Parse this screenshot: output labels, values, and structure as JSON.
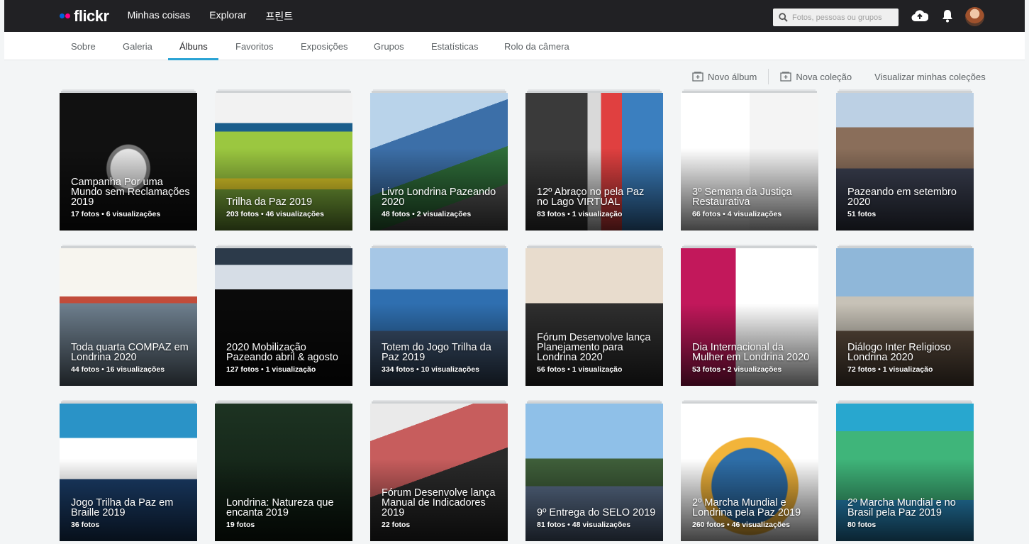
{
  "header": {
    "logo_text": "flickr",
    "nav": [
      "Minhas coisas",
      "Explorar",
      "프린트"
    ],
    "search_placeholder": "Fotos, pessoas ou grupos"
  },
  "subnav": {
    "tabs": [
      "Sobre",
      "Galeria",
      "Álbuns",
      "Favoritos",
      "Exposições",
      "Grupos",
      "Estatísticas",
      "Rolo da câmera"
    ],
    "active": "Álbuns"
  },
  "actions": {
    "new_album": "Novo álbum",
    "new_collection": "Nova coleção",
    "view_collections": "Visualizar minhas coleções"
  },
  "albums": [
    {
      "title": "Campanha Por uma Mundo sem Reclamações 2019",
      "stats": "17 fotos  •  6 visualizações"
    },
    {
      "title": "Trilha da Paz 2019",
      "stats": "203 fotos  •  46 visualizações"
    },
    {
      "title": "Livro Londrina Pazeando 2020",
      "stats": "48 fotos  •  2 visualizações"
    },
    {
      "title": "12º Abraço no pela Paz no Lago VIRTUAL",
      "stats": "83 fotos  •  1 visualização"
    },
    {
      "title": "3º Semana da Justiça Restaurativa",
      "stats": "66 fotos  •  4 visualizações"
    },
    {
      "title": "Pazeando em setembro 2020",
      "stats": "51 fotos"
    },
    {
      "title": "Toda quarta COMPAZ em Londrina 2020",
      "stats": "44 fotos  •  16 visualizações"
    },
    {
      "title": "2020 Mobilização Pazeando abril & agosto",
      "stats": "127 fotos  •  1 visualização"
    },
    {
      "title": "Totem do Jogo Trilha da Paz 2019",
      "stats": "334 fotos  •  10 visualizações"
    },
    {
      "title": "Fórum Desenvolve lança Planejamento para Londrina 2020",
      "stats": "56 fotos  •  1 visualização"
    },
    {
      "title": "Dia Internacional da Mulher em Londrina 2020",
      "stats": "53 fotos  •  2 visualizações"
    },
    {
      "title": "Diálogo Inter Religioso Londrina 2020",
      "stats": "72 fotos  •  1 visualização"
    },
    {
      "title": "Jogo Trilha da Paz em Braille 2019",
      "stats": "36 fotos"
    },
    {
      "title": "Londrina: Natureza que encanta 2019",
      "stats": "19 fotos"
    },
    {
      "title": "Fórum Desenvolve lança Manual de Indicadores 2019",
      "stats": "22 fotos"
    },
    {
      "title": "9º Entrega do SELO 2019",
      "stats": "81 fotos  •  48 visualizações"
    },
    {
      "title": "2º Marcha Mundial e Londrina pela Paz 2019",
      "stats": "260 fotos  •  46 visualizações"
    },
    {
      "title": "2º Marcha Mundial e no Brasil pela Paz 2019",
      "stats": "80 fotos"
    }
  ],
  "colors": {
    "topbar": "#212124",
    "flickr_blue": "#0063dc",
    "flickr_pink": "#ff0084",
    "tab_underline": "#2aa3d4"
  }
}
